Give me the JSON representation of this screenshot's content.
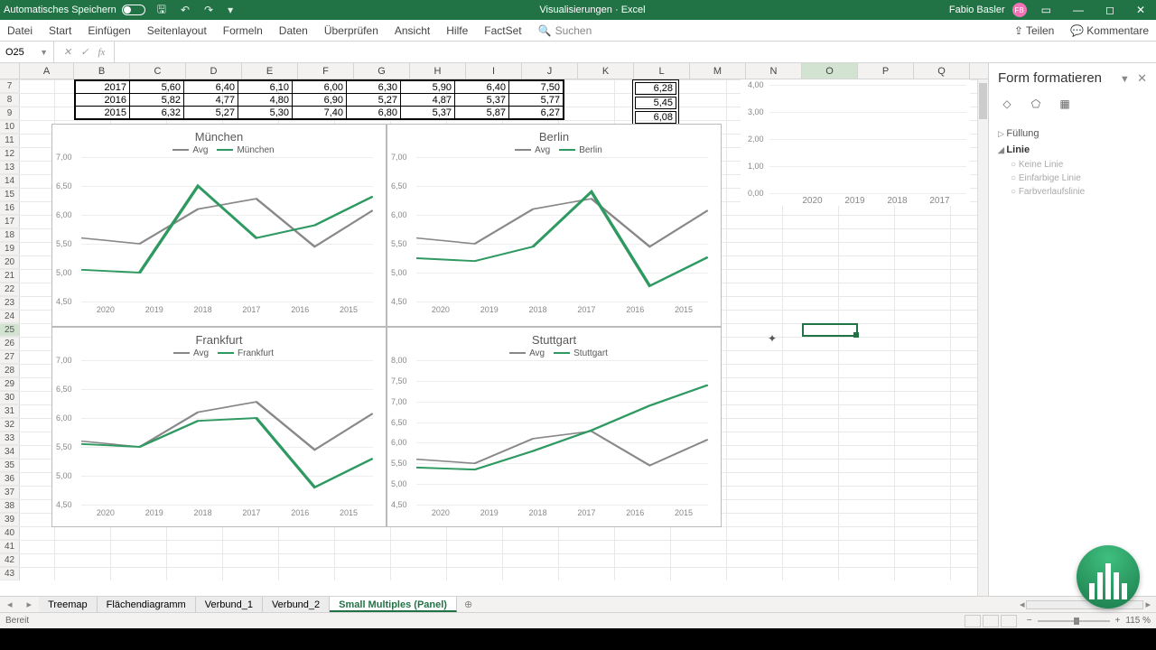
{
  "titlebar": {
    "autosave": "Automatisches Speichern",
    "doc": "Visualisierungen",
    "app": "Excel",
    "user": "Fabio Basler",
    "badge": "FB"
  },
  "ribbon": {
    "tabs": [
      "Datei",
      "Start",
      "Einfügen",
      "Seitenlayout",
      "Formeln",
      "Daten",
      "Überprüfen",
      "Ansicht",
      "Hilfe",
      "FactSet"
    ],
    "search": "Suchen",
    "share": "Teilen",
    "comments": "Kommentare"
  },
  "namebox": "O25",
  "columns": [
    "A",
    "B",
    "C",
    "D",
    "E",
    "F",
    "G",
    "H",
    "I",
    "J",
    "K",
    "L",
    "M",
    "N",
    "O",
    "P",
    "Q"
  ],
  "row_start": 7,
  "row_end": 43,
  "data_rows": [
    {
      "year": "2017",
      "v": [
        "5,60",
        "6,40",
        "6,10",
        "6,00",
        "6,30",
        "5,90",
        "6,40",
        "7,50"
      ],
      "avg": "6,28"
    },
    {
      "year": "2016",
      "v": [
        "5,82",
        "4,77",
        "4,80",
        "6,90",
        "5,27",
        "4,87",
        "5,37",
        "5,77"
      ],
      "avg": "5,45"
    },
    {
      "year": "2015",
      "v": [
        "6,32",
        "5,27",
        "5,30",
        "7,40",
        "6,80",
        "5,37",
        "5,87",
        "6,27"
      ],
      "avg": "6,08"
    }
  ],
  "chart_data": [
    {
      "type": "line",
      "title": "München",
      "series_names": [
        "Avg",
        "München"
      ],
      "categories": [
        "2020",
        "2019",
        "2018",
        "2017",
        "2016",
        "2015"
      ],
      "avg": [
        5.6,
        5.5,
        6.1,
        6.28,
        5.45,
        6.08
      ],
      "city": [
        5.05,
        5.0,
        6.5,
        5.6,
        5.82,
        6.32
      ],
      "ymin": 4.5,
      "ymax": 7.0,
      "yticks": [
        "4,50",
        "5,00",
        "5,50",
        "6,00",
        "6,50",
        "7,00"
      ]
    },
    {
      "type": "line",
      "title": "Berlin",
      "series_names": [
        "Avg",
        "Berlin"
      ],
      "categories": [
        "2020",
        "2019",
        "2018",
        "2017",
        "2016",
        "2015"
      ],
      "avg": [
        5.6,
        5.5,
        6.1,
        6.28,
        5.45,
        6.08
      ],
      "city": [
        5.25,
        5.2,
        5.45,
        6.4,
        4.77,
        5.27
      ],
      "ymin": 4.5,
      "ymax": 7.0,
      "yticks": [
        "4,50",
        "5,00",
        "5,50",
        "6,00",
        "6,50",
        "7,00"
      ]
    },
    {
      "type": "line",
      "title": "Frankfurt",
      "series_names": [
        "Avg",
        "Frankfurt"
      ],
      "categories": [
        "2020",
        "2019",
        "2018",
        "2017",
        "2016",
        "2015"
      ],
      "avg": [
        5.6,
        5.5,
        6.1,
        6.28,
        5.45,
        6.08
      ],
      "city": [
        5.55,
        5.5,
        5.95,
        6.0,
        4.8,
        5.3
      ],
      "ymin": 4.5,
      "ymax": 7.0,
      "yticks": [
        "4,50",
        "5,00",
        "5,50",
        "6,00",
        "6,50",
        "7,00"
      ]
    },
    {
      "type": "line",
      "title": "Stuttgart",
      "series_names": [
        "Avg",
        "Stuttgart"
      ],
      "categories": [
        "2020",
        "2019",
        "2018",
        "2017",
        "2016",
        "2015"
      ],
      "avg": [
        5.6,
        5.5,
        6.1,
        6.28,
        5.45,
        6.08
      ],
      "city": [
        5.4,
        5.35,
        5.8,
        6.3,
        6.9,
        7.4
      ],
      "ymin": 4.5,
      "ymax": 8.0,
      "yticks": [
        "4,50",
        "5,00",
        "5,50",
        "6,00",
        "6,50",
        "7,00",
        "7,50",
        "8,00"
      ]
    }
  ],
  "partial_chart": {
    "yticks": [
      "0,00",
      "1,00",
      "2,00",
      "3,00",
      "4,00"
    ],
    "xcats": [
      "2020",
      "2019",
      "2018",
      "2017"
    ]
  },
  "side_pane": {
    "title": "Form formatieren",
    "sections": [
      "Füllung",
      "Linie"
    ],
    "line_options": [
      "Keine Linie",
      "Einfarbige Linie",
      "Farbverlaufslinie"
    ]
  },
  "sheet_tabs": [
    "Treemap",
    "Flächendiagramm",
    "Verbund_1",
    "Verbund_2",
    "Small Multiples (Panel)"
  ],
  "active_tab": 4,
  "status": {
    "ready": "Bereit",
    "zoom": "115 %"
  }
}
